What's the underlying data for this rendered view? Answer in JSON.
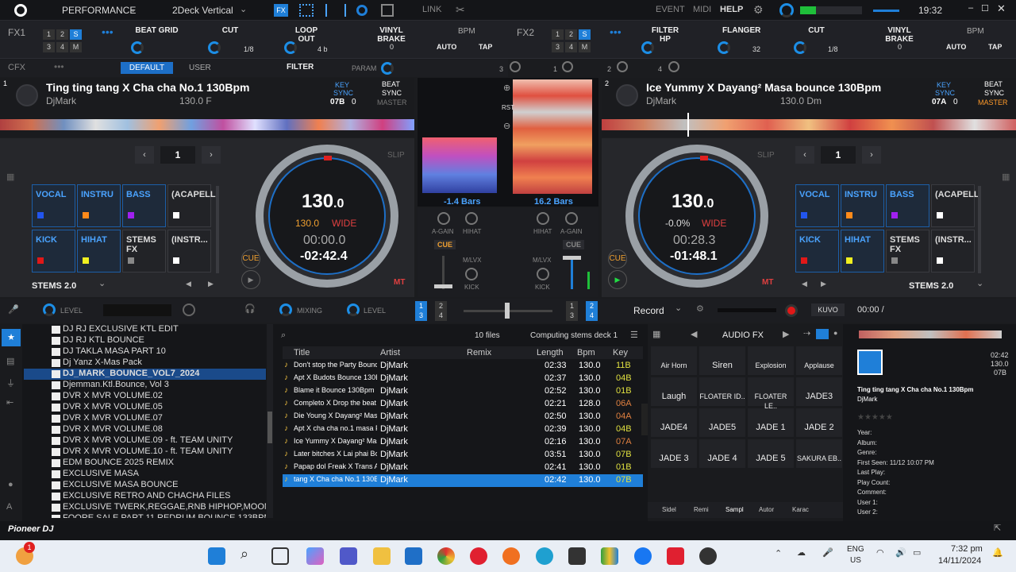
{
  "topbar": {
    "mode": "PERFORMANCE",
    "layout": "2Deck Vertical",
    "link": "LINK",
    "event": "EVENT",
    "midi": "MIDI",
    "help": "HELP",
    "time": "19:32"
  },
  "fx1": {
    "label": "FX1",
    "nums": [
      "1",
      "2",
      "S",
      "3",
      "4",
      "M"
    ],
    "effects": [
      "BEAT GRID",
      "CUT",
      "LOOP OUT"
    ],
    "vals": [
      "1/8",
      "4 b"
    ],
    "vinyl": "VINYL BRAKE",
    "vinyl_val": "0",
    "bpm": "BPM",
    "auto": "AUTO",
    "tap": "TAP"
  },
  "fx2": {
    "label": "FX2",
    "nums": [
      "1",
      "2",
      "S",
      "3",
      "4",
      "M"
    ],
    "effects": [
      "FILTER HP",
      "FLANGER",
      "CUT"
    ],
    "vals": [
      "32",
      "1/8"
    ],
    "vinyl": "VINYL BRAKE",
    "vinyl_val": "0",
    "bpm": "BPM",
    "auto": "AUTO",
    "tap": "TAP"
  },
  "cfx": {
    "label": "CFX",
    "default": "DEFAULT",
    "user": "USER",
    "filter": "FILTER",
    "param": "PARAM",
    "nums": [
      "3",
      "1",
      "2",
      "4"
    ]
  },
  "deck1": {
    "num": "1",
    "title": "Ting ting tang X Cha cha No.1 130Bpm",
    "artist": "DjMark",
    "bpm_key": "130.0  F",
    "key_label": "KEY",
    "sync": "SYNC",
    "key_val": "07B",
    "key_off": "0",
    "beat": "BEAT",
    "beat_sync": "SYNC",
    "master": "MASTER",
    "loop": "1",
    "slip": "SLIP",
    "bpm": "130",
    "bpm_dec": ".0",
    "pitch": "130.0",
    "wide": "WIDE",
    "elapsed": "00:00.0",
    "remain": "-02:42.4",
    "cue": "CUE",
    "mt": "MT",
    "stems": "STEMS 2.0"
  },
  "deck2": {
    "num": "2",
    "title": "Ice Yummy X Dayang² Masa bounce 130Bpm",
    "artist": "DjMark",
    "bpm_key": "130.0  Dm",
    "key_label": "KEY",
    "sync": "SYNC",
    "key_val": "07A",
    "key_off": "0",
    "beat": "BEAT",
    "beat_sync": "SYNC",
    "master": "MASTER",
    "loop": "1",
    "slip": "SLIP",
    "bpm": "130",
    "bpm_dec": ".0",
    "pitch": "-0.0%",
    "wide": "WIDE",
    "elapsed": "00:28.3",
    "remain": "-01:48.1",
    "cue": "CUE",
    "mt": "MT",
    "stems": "STEMS 2.0"
  },
  "pads1": [
    {
      "label": "VOCAL",
      "c": "#2255ee"
    },
    {
      "label": "INSTRU",
      "c": "#ff8a1a"
    },
    {
      "label": "BASS",
      "c": "#a020f0"
    },
    {
      "label": "(ACAPELL",
      "c": "#ffffff"
    },
    {
      "label": "KICK",
      "c": "#e01818"
    },
    {
      "label": "HIHAT",
      "c": "#f0f020"
    },
    {
      "label": "STEMS FX",
      "c": "#888888"
    },
    {
      "label": "(INSTR...",
      "c": "#ffffff"
    }
  ],
  "pads2": [
    {
      "label": "VOCAL",
      "c": "#2255ee"
    },
    {
      "label": "INSTRU",
      "c": "#ff8a1a"
    },
    {
      "label": "BASS",
      "c": "#a020f0"
    },
    {
      "label": "(ACAPELL",
      "c": "#ffffff"
    },
    {
      "label": "KICK",
      "c": "#e01818"
    },
    {
      "label": "HIHAT",
      "c": "#f0f020"
    },
    {
      "label": "STEMS FX",
      "c": "#888888"
    },
    {
      "label": "(INSTR...",
      "c": "#ffffff"
    }
  ],
  "mixer": {
    "bars1": "-1.4 Bars",
    "bars2": "16.2 Bars",
    "rst": "RST",
    "again": "A-GAIN",
    "hihat": "HIHAT",
    "cue": "CUE",
    "mlvx": "M/LVX",
    "kick": "KICK"
  },
  "midbar": {
    "level": "LEVEL",
    "mixing": "MIXING",
    "level2": "LEVEL",
    "record": "Record",
    "kuvo": "KUVO",
    "rectime": "00:00 /",
    "nums": [
      "1",
      "2",
      "3",
      "4"
    ]
  },
  "tree": [
    "DJ RJ EXCLUSIVE KTL EDIT",
    "DJ RJ KTL BOUNCE",
    "DJ TAKLA MASA PART 10",
    "Dj Yanz X-Mas Pack",
    "DJ_MARK_BOUNCE_VOL7_2024",
    "Djemman.Ktl.Bounce,  Vol 3",
    "DVR X MVR VOLUME.02",
    "DVR X MVR VOLUME.05",
    "DVR X MVR VOLUME.07",
    "DVR X MVR VOLUME.08",
    "DVR X MVR VOLUME.09 - ft. TEAM UNITY",
    "DVR X MVR VOLUME.10 - ft. TEAM UNITY",
    "EDM BOUNCE 2025 REMIX",
    "EXCLUSIVE MASA",
    "EXCLUSIVE MASA BOUNCE",
    "EXCLUSIVE RETRO AND CHACHA FILES",
    "EXCLUSIVE TWERK,REGGAE,RNB HIPHOP,MOOMBATHON",
    "FOORE SALE PART 11 REDRUM BOUNCE 133BPM"
  ],
  "list": {
    "count": "10 files",
    "status": "Computing stems deck 1",
    "cols": [
      "Title",
      "Artist",
      "Remix",
      "Length",
      "Bpm",
      "Key"
    ],
    "rows": [
      [
        "Don't stop the Party Bounce..",
        "DjMark",
        "",
        "02:33",
        "130.0",
        "11B"
      ],
      [
        "Apt X Budots Bounce 130Bpm",
        "DjMark",
        "",
        "02:37",
        "130.0",
        "04B"
      ],
      [
        "Blame it Bounce 130Bpm",
        "DjMark",
        "",
        "02:52",
        "130.0",
        "01B"
      ],
      [
        "Completo X Drop the beat B..",
        "DjMark",
        "",
        "02:21",
        "128.0",
        "06A"
      ],
      [
        "Die Young X Dayang² Masa..",
        "DjMark",
        "",
        "02:50",
        "130.0",
        "04A"
      ],
      [
        "Apt X cha cha no.1  masa P..",
        "DjMark",
        "",
        "02:39",
        "130.0",
        "04B"
      ],
      [
        "Ice Yummy X Dayang² Masa..",
        "DjMark",
        "",
        "02:16",
        "130.0",
        "07A"
      ],
      [
        "Later bitches X Lai phai Bou..",
        "DjMark",
        "",
        "03:51",
        "130.0",
        "07B"
      ],
      [
        "Papap dol Freak X Trans Aff..",
        "DjMark",
        "",
        "02:41",
        "130.0",
        "01B"
      ],
      [
        "tang X Cha cha No.1 130Bpm",
        "DjMark",
        "",
        "02:42",
        "130.0",
        "07B"
      ]
    ]
  },
  "sampler": {
    "title": "AUDIO FX",
    "pads": [
      "Air Horn",
      "Siren",
      "Explosion",
      "Applause",
      "Laugh",
      "FLOATER ID..",
      "FLOATER LE..",
      "JADE3",
      "JADE4",
      "JADE5",
      "JADE 1",
      "JADE 2",
      "JADE 3",
      "JADE 4",
      "JADE 5",
      "SAKURA EB.."
    ],
    "tabs": [
      "Sidel",
      "Remi",
      "Sampl",
      "Autor",
      "Karac"
    ]
  },
  "info": {
    "len": "02:42",
    "bpm": "130.0",
    "key": "07B",
    "title": "Ting ting tang X Cha cha No.1 130Bpm",
    "artist": "DjMark",
    "fields": [
      "Year:",
      "Album:",
      "Genre:",
      "First Seen: 11/12 10:07 PM",
      "Last Play:",
      "Play Count:",
      "Comment:",
      "User 1:",
      "User 2:"
    ]
  },
  "brand": "Pioneer DJ",
  "taskbar": {
    "lang": "ENG",
    "region": "US",
    "time": "7:32 pm",
    "date": "14/11/2024",
    "badge": "1"
  }
}
